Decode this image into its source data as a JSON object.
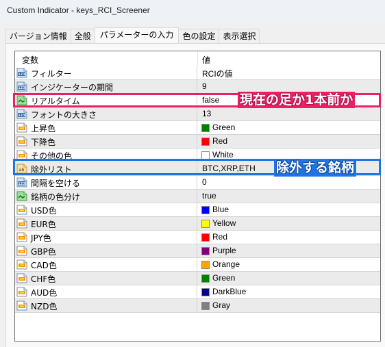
{
  "window": {
    "title": "Custom Indicator - keys_RCI_Screener"
  },
  "tabs": [
    {
      "label": "バージョン情報",
      "active": false
    },
    {
      "label": "全般",
      "active": false
    },
    {
      "label": "パラメーターの入力",
      "active": true
    },
    {
      "label": "色の設定",
      "active": false
    },
    {
      "label": "表示選択",
      "active": false
    }
  ],
  "table": {
    "headers": {
      "variable": "変数",
      "value": "値"
    },
    "rows": [
      {
        "icon": "int-icon",
        "name": "フィルター",
        "value": "RCIの値"
      },
      {
        "icon": "int-icon",
        "name": "インジケーターの期間",
        "value": "9"
      },
      {
        "icon": "bool-icon",
        "name": "リアルタイム",
        "value": "false"
      },
      {
        "icon": "int-icon",
        "name": "フォントの大きさ",
        "value": "13"
      },
      {
        "icon": "color-icon",
        "name": "上昇色",
        "value": "Green",
        "swatch": "#008000"
      },
      {
        "icon": "color-icon",
        "name": "下降色",
        "value": "Red",
        "swatch": "#ff0000"
      },
      {
        "icon": "color-icon",
        "name": "その他の色",
        "value": "White",
        "swatch": "#ffffff"
      },
      {
        "icon": "string-icon",
        "name": "除外リスト",
        "value": "BTC,XRP,ETH"
      },
      {
        "icon": "int-icon",
        "name": "間隔を空ける",
        "value": "0"
      },
      {
        "icon": "bool-icon",
        "name": "銘柄の色分け",
        "value": "true"
      },
      {
        "icon": "color-icon",
        "name": "USD色",
        "value": "Blue",
        "swatch": "#0000ff"
      },
      {
        "icon": "color-icon",
        "name": "EUR色",
        "value": "Yellow",
        "swatch": "#ffff00"
      },
      {
        "icon": "color-icon",
        "name": "JPY色",
        "value": "Red",
        "swatch": "#ff0000"
      },
      {
        "icon": "color-icon",
        "name": "GBP色",
        "value": "Purple",
        "swatch": "#800080"
      },
      {
        "icon": "color-icon",
        "name": "CAD色",
        "value": "Orange",
        "swatch": "#ffa500"
      },
      {
        "icon": "color-icon",
        "name": "CHF色",
        "value": "Green",
        "swatch": "#008000"
      },
      {
        "icon": "color-icon",
        "name": "AUD色",
        "value": "DarkBlue",
        "swatch": "#00008b"
      },
      {
        "icon": "color-icon",
        "name": "NZD色",
        "value": "Gray",
        "swatch": "#808080"
      }
    ]
  },
  "annotations": {
    "realtime": {
      "text": "現在の足か1本前か",
      "color": "#ee1e63"
    },
    "exclude": {
      "text": "除外する銘柄",
      "color": "#1f74e6"
    }
  }
}
